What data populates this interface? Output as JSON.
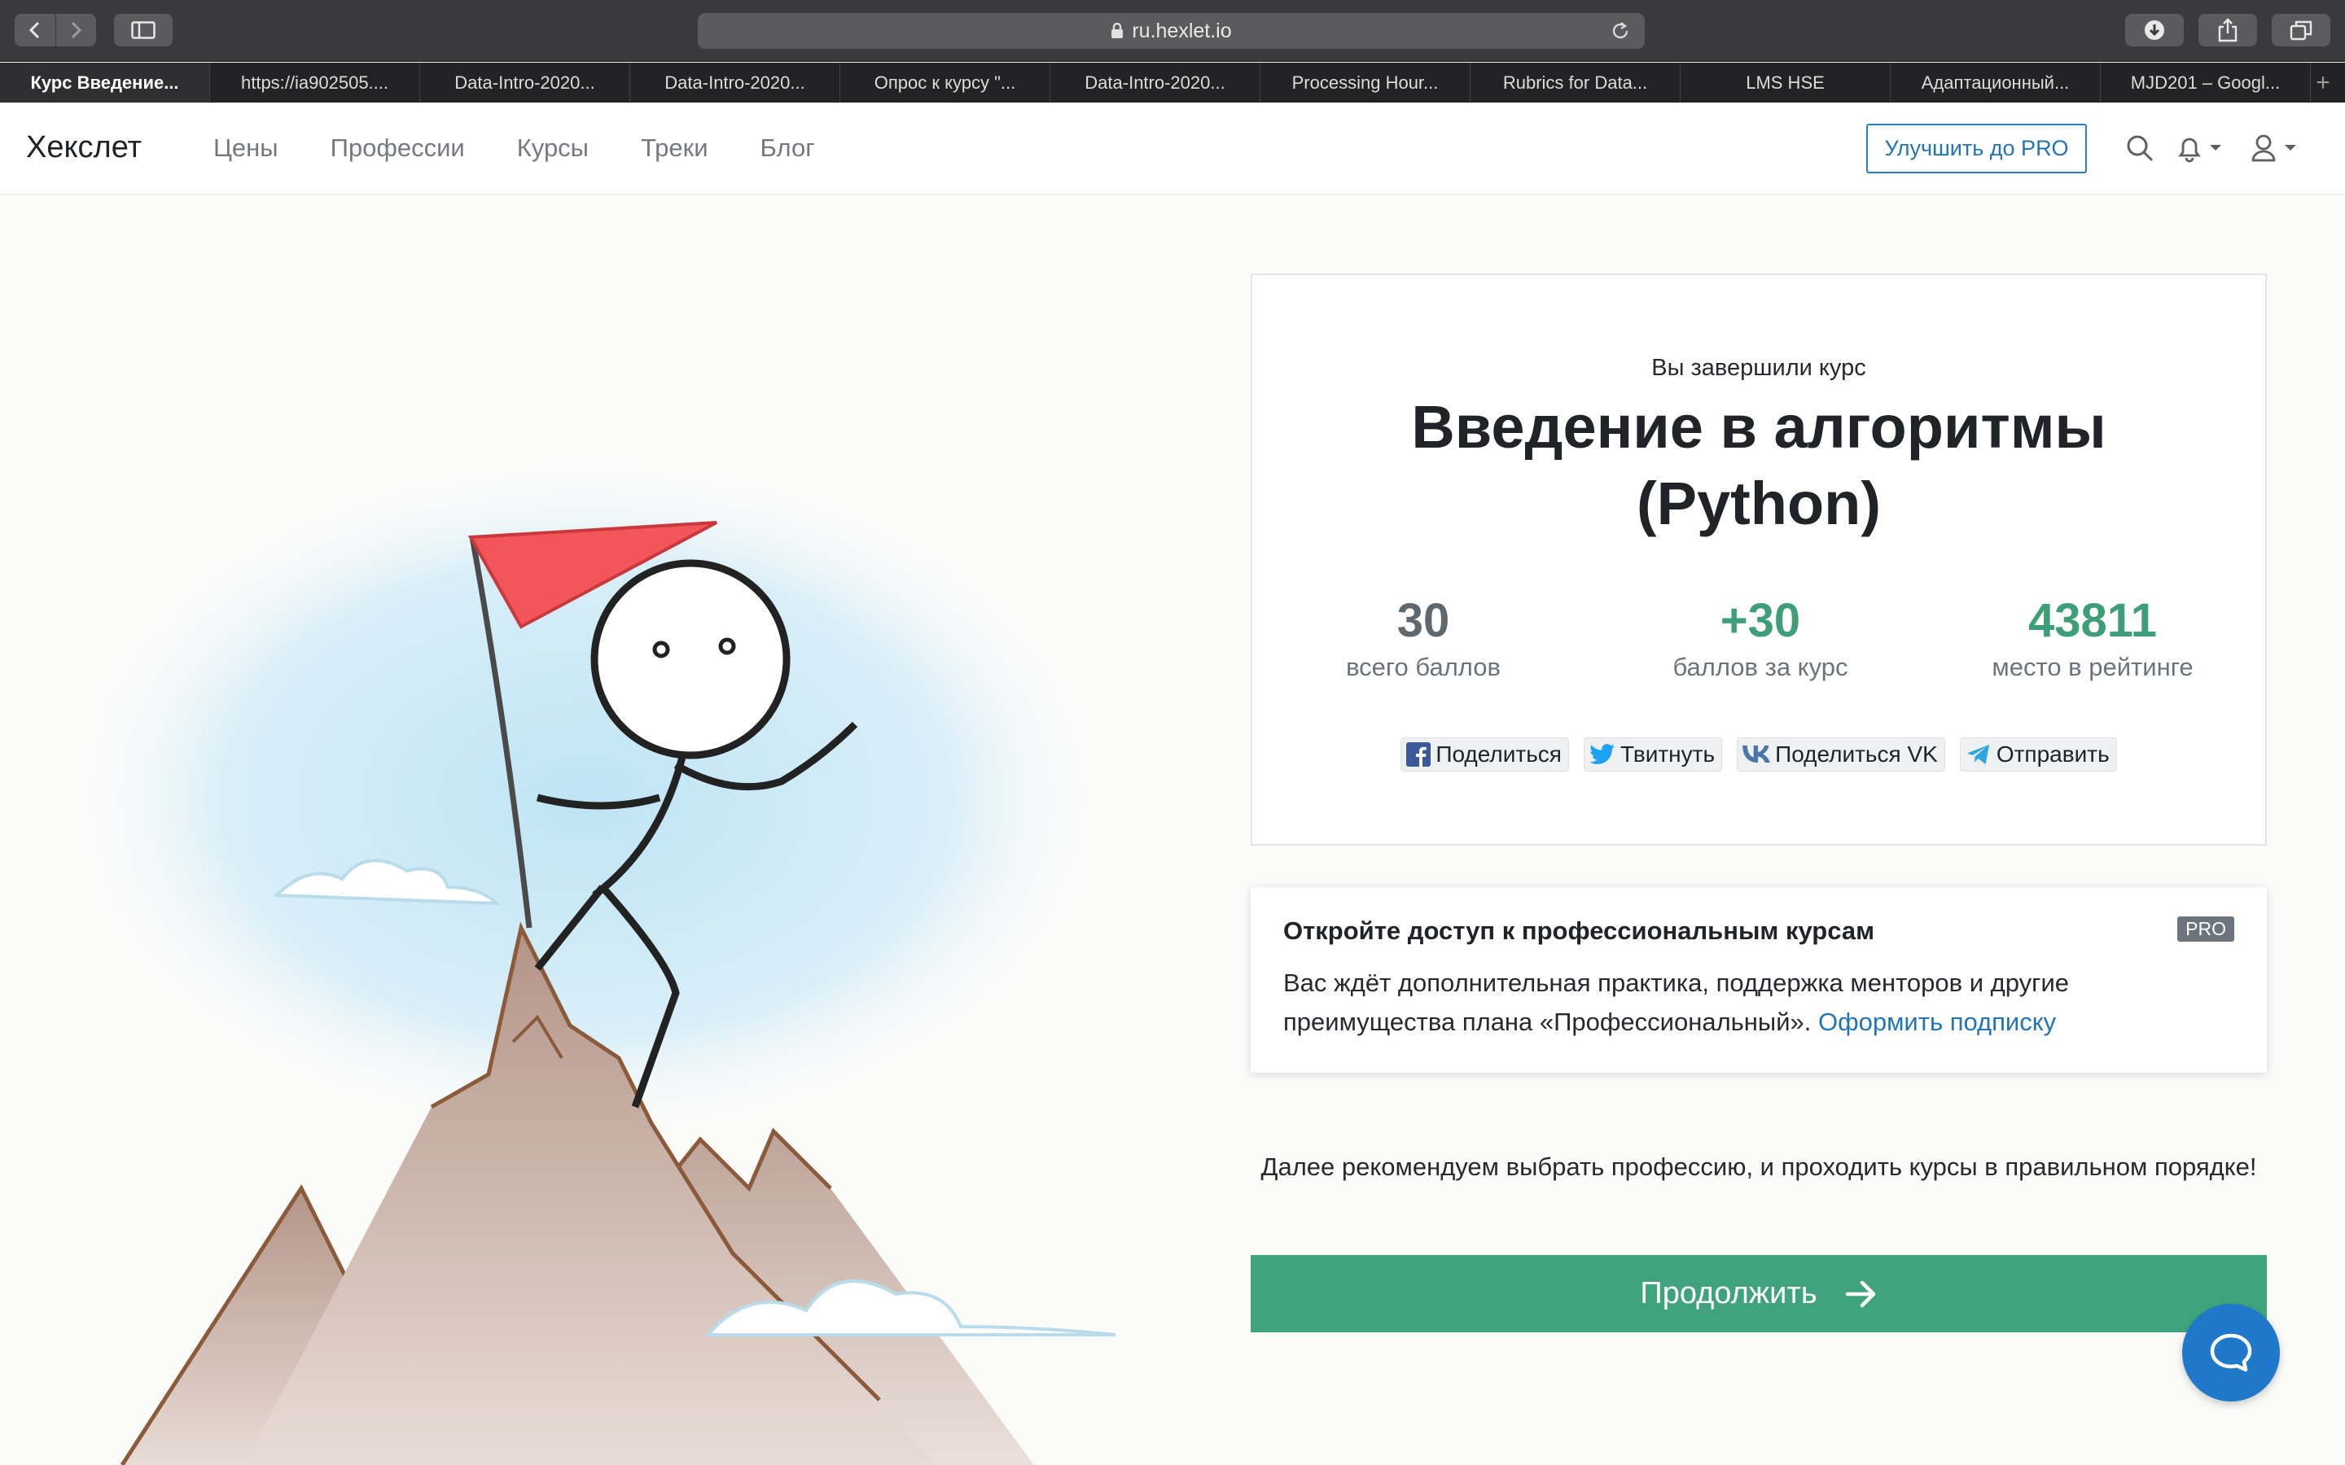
{
  "browser": {
    "url": "ru.hexlet.io",
    "tabs": [
      {
        "label": "Курс Введение...",
        "active": true
      },
      {
        "label": "https://ia902505...."
      },
      {
        "label": "Data-Intro-2020..."
      },
      {
        "label": "Data-Intro-2020..."
      },
      {
        "label": "Опрос к курсу \"..."
      },
      {
        "label": "Data-Intro-2020..."
      },
      {
        "label": "Processing Hour..."
      },
      {
        "label": "Rubrics for Data..."
      },
      {
        "label": "LMS HSE"
      },
      {
        "label": "Адаптационный..."
      },
      {
        "label": "MJD201 – Googl..."
      }
    ],
    "new_tab": "+"
  },
  "header": {
    "logo": "Хекслет",
    "nav": [
      "Цены",
      "Профессии",
      "Курсы",
      "Треки",
      "Блог"
    ],
    "pro_button": "Улучшить до PRO",
    "icons": [
      "search-icon",
      "bell-icon",
      "user-icon"
    ]
  },
  "completion": {
    "subtitle": "Вы завершили курс",
    "course_title_line1": "Введение в алгоритмы",
    "course_title_line2": "(Python)",
    "stats": [
      {
        "value": "30",
        "label": "всего баллов",
        "color": "#5f676f"
      },
      {
        "value": "+30",
        "label": "баллов за курс",
        "color": "#3e9e78"
      },
      {
        "value": "43811",
        "label": "место в рейтинге",
        "color": "#3e9e78"
      }
    ],
    "share": [
      {
        "label": "Поделиться",
        "icon": "facebook-icon"
      },
      {
        "label": "Твитнуть",
        "icon": "twitter-icon"
      },
      {
        "label": "Поделиться VK",
        "icon": "vk-icon"
      },
      {
        "label": "Отправить",
        "icon": "telegram-icon"
      }
    ]
  },
  "pro_promo": {
    "title": "Откройте доступ к профессиональным курсам",
    "badge": "PRO",
    "text": "Вас ждёт дополнительная практика, поддержка менторов и другие преимущества плана «Профессиональный».",
    "link": "Оформить подписку"
  },
  "recommendation": "Далее рекомендуем выбрать профессию, и проходить курсы в правильном порядке!",
  "continue_button": "Продолжить",
  "colors": {
    "accent_green": "#3fa47e",
    "link_blue": "#2274b8",
    "chat_blue": "#1f78c9"
  }
}
